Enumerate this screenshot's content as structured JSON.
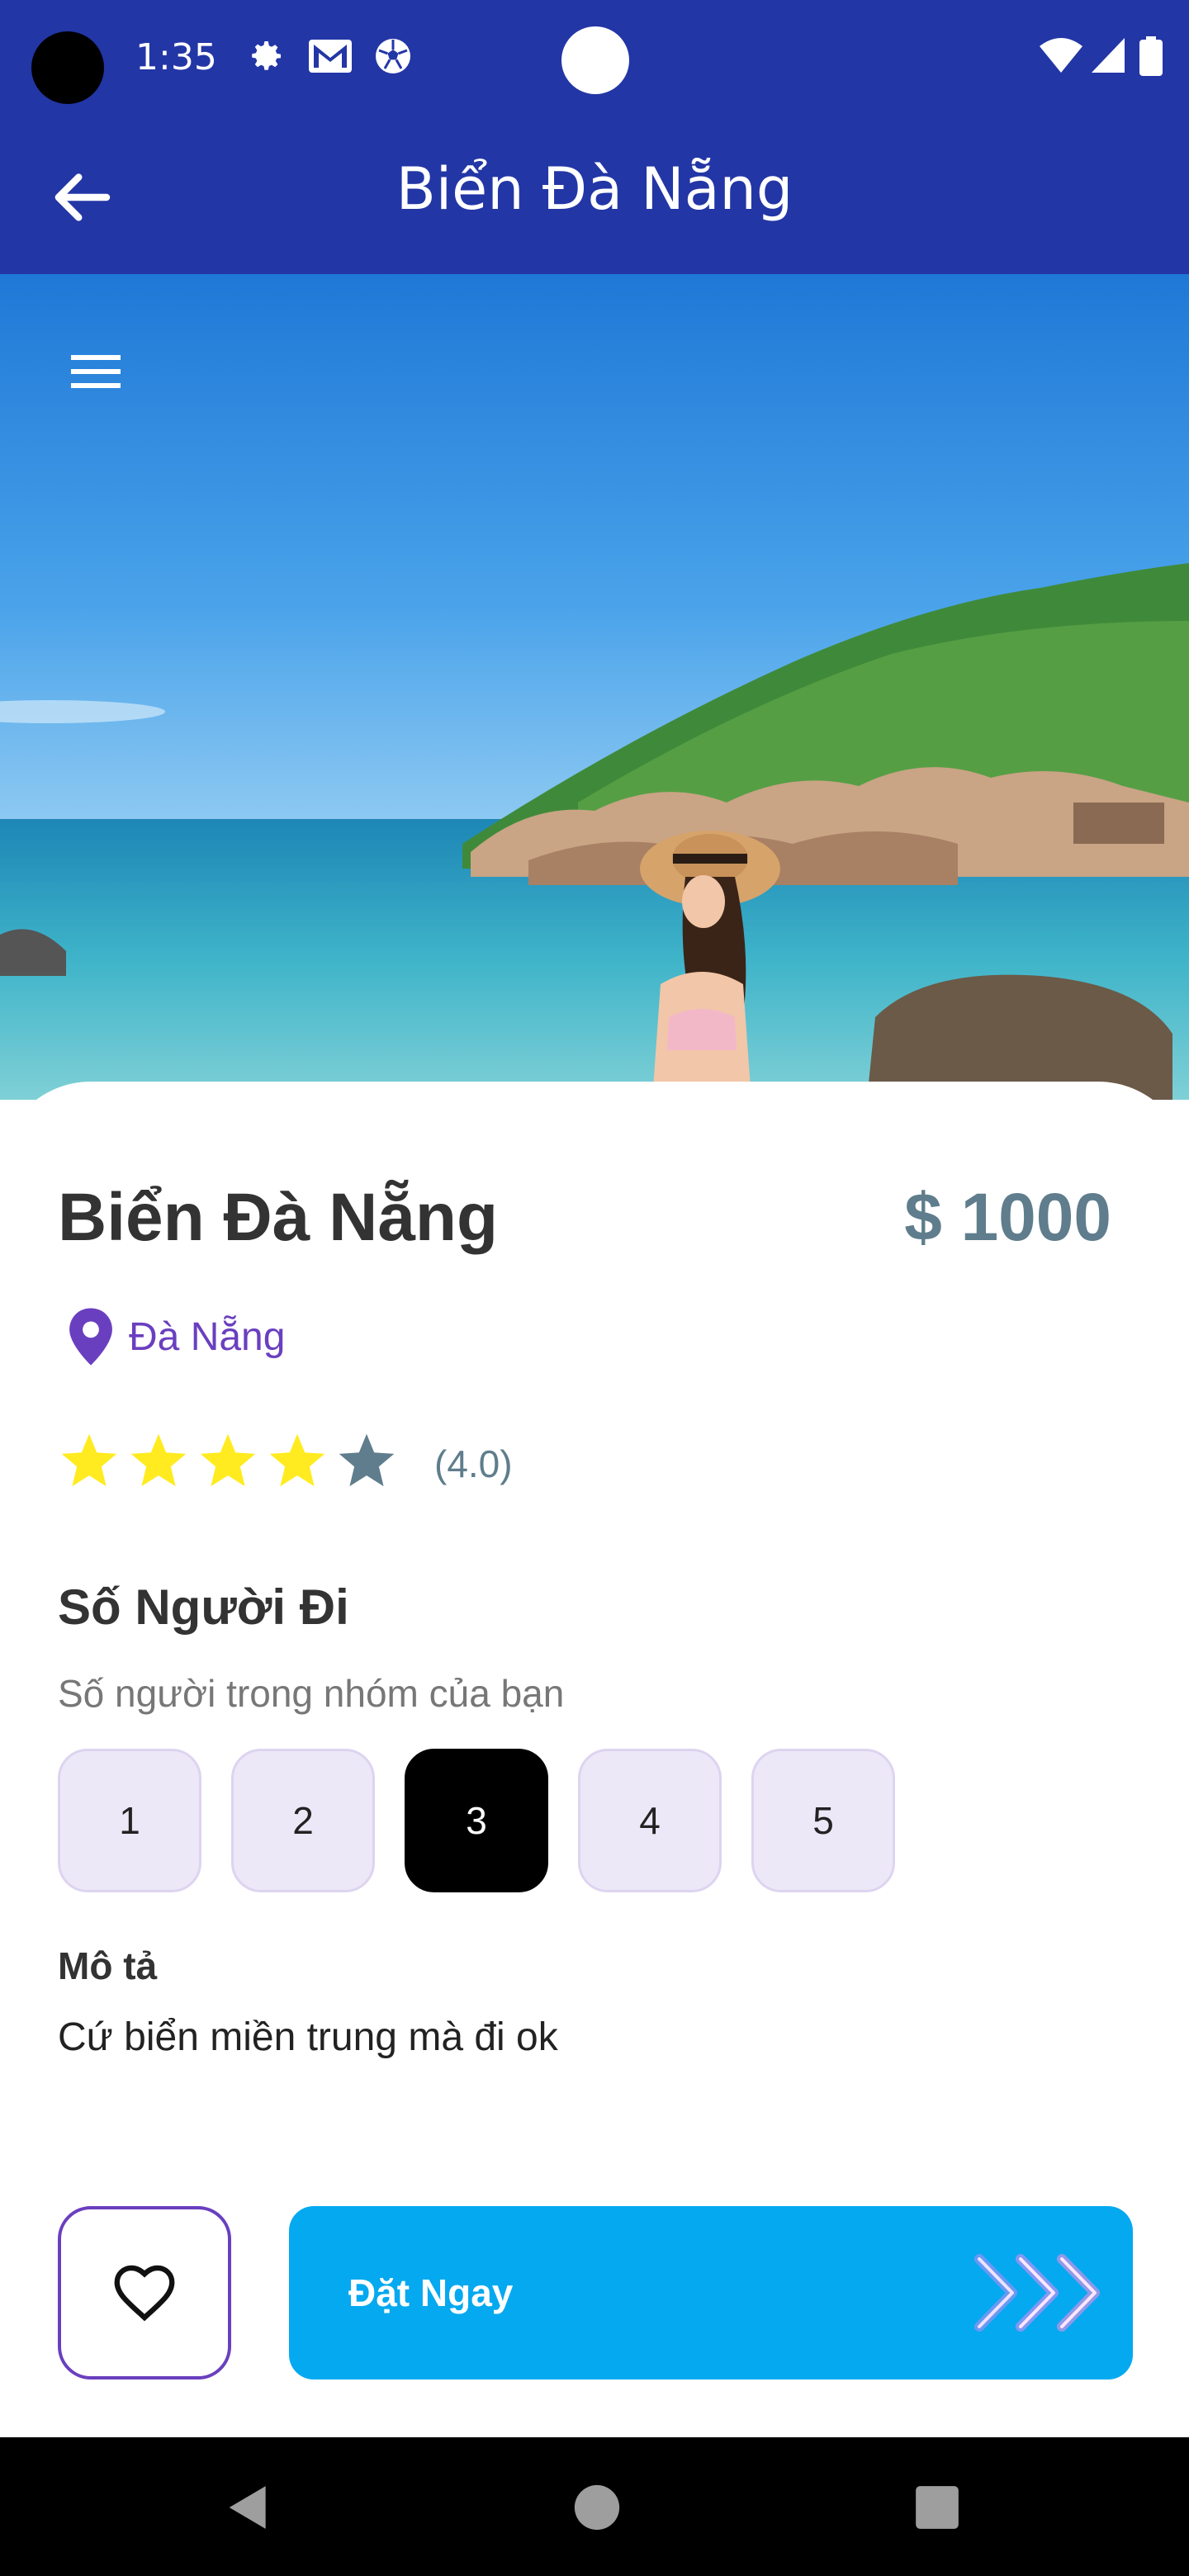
{
  "status_bar": {
    "time": "1:35",
    "icons": [
      "gear-icon",
      "gmail-icon",
      "soccer-ball-icon",
      "wifi-icon",
      "signal-icon",
      "battery-icon"
    ]
  },
  "app_bar": {
    "title": "Biển Đà Nẵng",
    "back_icon": "arrow-left-icon"
  },
  "hero": {
    "menu_icon": "hamburger-menu-icon"
  },
  "place": {
    "name": "Biển Đà Nẵng",
    "price": "$ 1000",
    "location": "Đà Nẵng",
    "rating_value": 4,
    "rating_max": 5,
    "rating_text": "(4.0)"
  },
  "group": {
    "title": "Số Người Đi",
    "subtitle": "Số người trong nhóm của bạn",
    "options": [
      "1",
      "2",
      "3",
      "4",
      "5"
    ],
    "selected": "3"
  },
  "description": {
    "title": "Mô tả",
    "text": "Cứ biển miền trung mà đi ok"
  },
  "actions": {
    "favorite_icon": "heart-outline-icon",
    "book_label": "Đặt Ngay"
  },
  "colors": {
    "app_bar": "#2336a6",
    "price": "#5f7d8c",
    "location": "#6a3fbf",
    "star_filled": "#ffeb1f",
    "star_empty": "#5f7d8c",
    "chip_bg": "#ede8f7",
    "chip_selected": "#000000",
    "book_button": "#05a9f0"
  }
}
